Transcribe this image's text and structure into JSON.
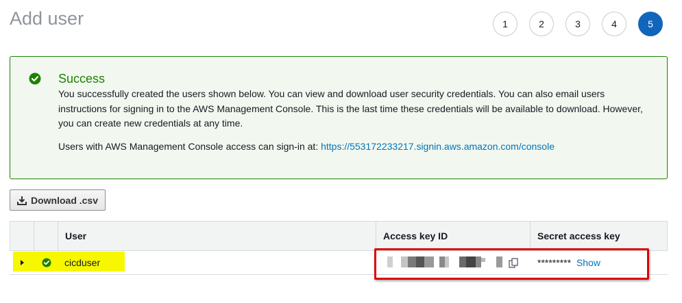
{
  "page": {
    "title": "Add user"
  },
  "steps": [
    {
      "label": "1",
      "active": false
    },
    {
      "label": "2",
      "active": false
    },
    {
      "label": "3",
      "active": false
    },
    {
      "label": "4",
      "active": false
    },
    {
      "label": "5",
      "active": true
    }
  ],
  "alert": {
    "icon": "check-circle-icon",
    "title": "Success",
    "body": "You successfully created the users shown below. You can view and download user security credentials. You can also email users instructions for signing in to the AWS Management Console. This is the last time these credentials will be available to download. However, you can create new credentials at any time.",
    "signin_prefix": "Users with AWS Management Console access can sign-in at: ",
    "signin_url": "https://553172233217.signin.aws.amazon.com/console",
    "success_color": "#1d8102"
  },
  "toolbar": {
    "download_label": "Download .csv",
    "download_icon": "download-icon"
  },
  "table": {
    "headers": [
      "",
      "",
      "User",
      "Access key ID",
      "Secret access key"
    ],
    "rows": [
      {
        "user": "cicduser",
        "status_icon": "check-circle-icon",
        "secret_masked": "*********",
        "show_label": "Show"
      }
    ]
  },
  "colors": {
    "accent": "#1166bb",
    "link": "#0073bb",
    "highlight": "#f7f700",
    "annotation_box": "#e00000"
  }
}
